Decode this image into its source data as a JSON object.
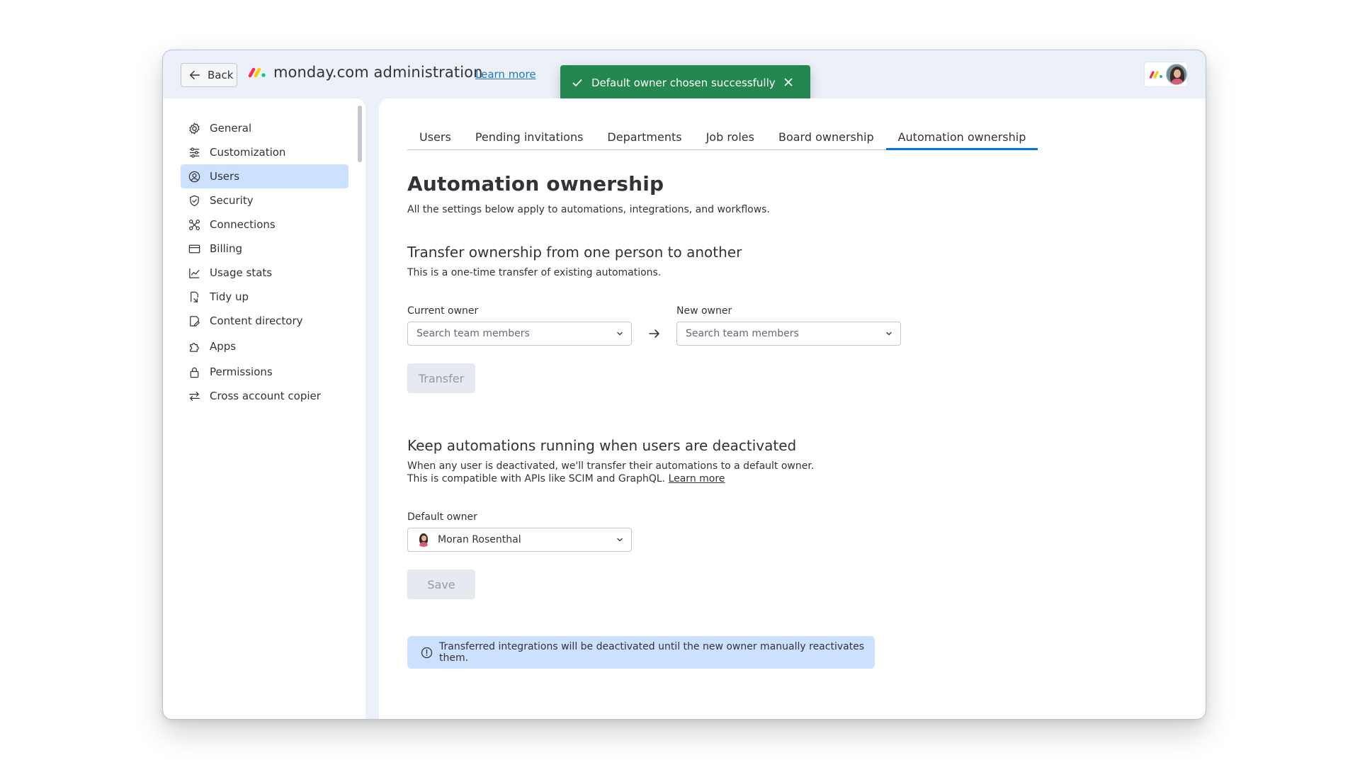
{
  "header": {
    "back_label": "Back",
    "title": "monday.com administration",
    "learn_more": "Learn more"
  },
  "toast": {
    "message": "Default owner chosen successfully",
    "color": "#258750"
  },
  "sidebar": {
    "items": [
      {
        "label": "General",
        "icon": "gear-icon"
      },
      {
        "label": "Customization",
        "icon": "sliders-icon"
      },
      {
        "label": "Users",
        "icon": "user-circle-icon",
        "active": true
      },
      {
        "label": "Security",
        "icon": "shield-icon"
      },
      {
        "label": "Connections",
        "icon": "connections-icon"
      },
      {
        "label": "Billing",
        "icon": "credit-card-icon"
      },
      {
        "label": "Usage stats",
        "icon": "chart-icon"
      },
      {
        "label": "Tidy up",
        "icon": "broom-icon"
      },
      {
        "label": "Content directory",
        "icon": "content-directory-icon"
      },
      {
        "label": "Apps",
        "icon": "puzzle-icon"
      },
      {
        "label": "Permissions",
        "icon": "lock-icon"
      },
      {
        "label": "Cross account copier",
        "icon": "swap-arrows-icon"
      }
    ]
  },
  "tabs": [
    {
      "label": "Users"
    },
    {
      "label": "Pending invitations"
    },
    {
      "label": "Departments"
    },
    {
      "label": "Job roles"
    },
    {
      "label": "Board ownership"
    },
    {
      "label": "Automation ownership",
      "active": true
    }
  ],
  "main": {
    "title": "Automation ownership",
    "subtitle": "All the settings below apply to automations, integrations, and workflows.",
    "transfer": {
      "heading": "Transfer ownership from one person to another",
      "description": "This is a one-time transfer of existing automations.",
      "current_owner_label": "Current owner",
      "current_owner_placeholder": "Search team members",
      "new_owner_label": "New owner",
      "new_owner_placeholder": "Search team members",
      "button_label": "Transfer"
    },
    "deactivated": {
      "heading": "Keep automations running when users are deactivated",
      "line1": "When any user is deactivated, we'll transfer their automations to a default owner.",
      "line2": "This is compatible with APIs like SCIM and GraphQL.",
      "learn_more": "Learn more",
      "default_owner_label": "Default owner",
      "default_owner_value": "Moran Rosenthal",
      "button_label": "Save"
    },
    "info_message": "Transferred integrations will be deactivated until the new owner manually reactivates them."
  },
  "colors": {
    "accent": "#0073ea",
    "active_nav": "#cce1ff",
    "info_bg": "#cce1ff"
  }
}
